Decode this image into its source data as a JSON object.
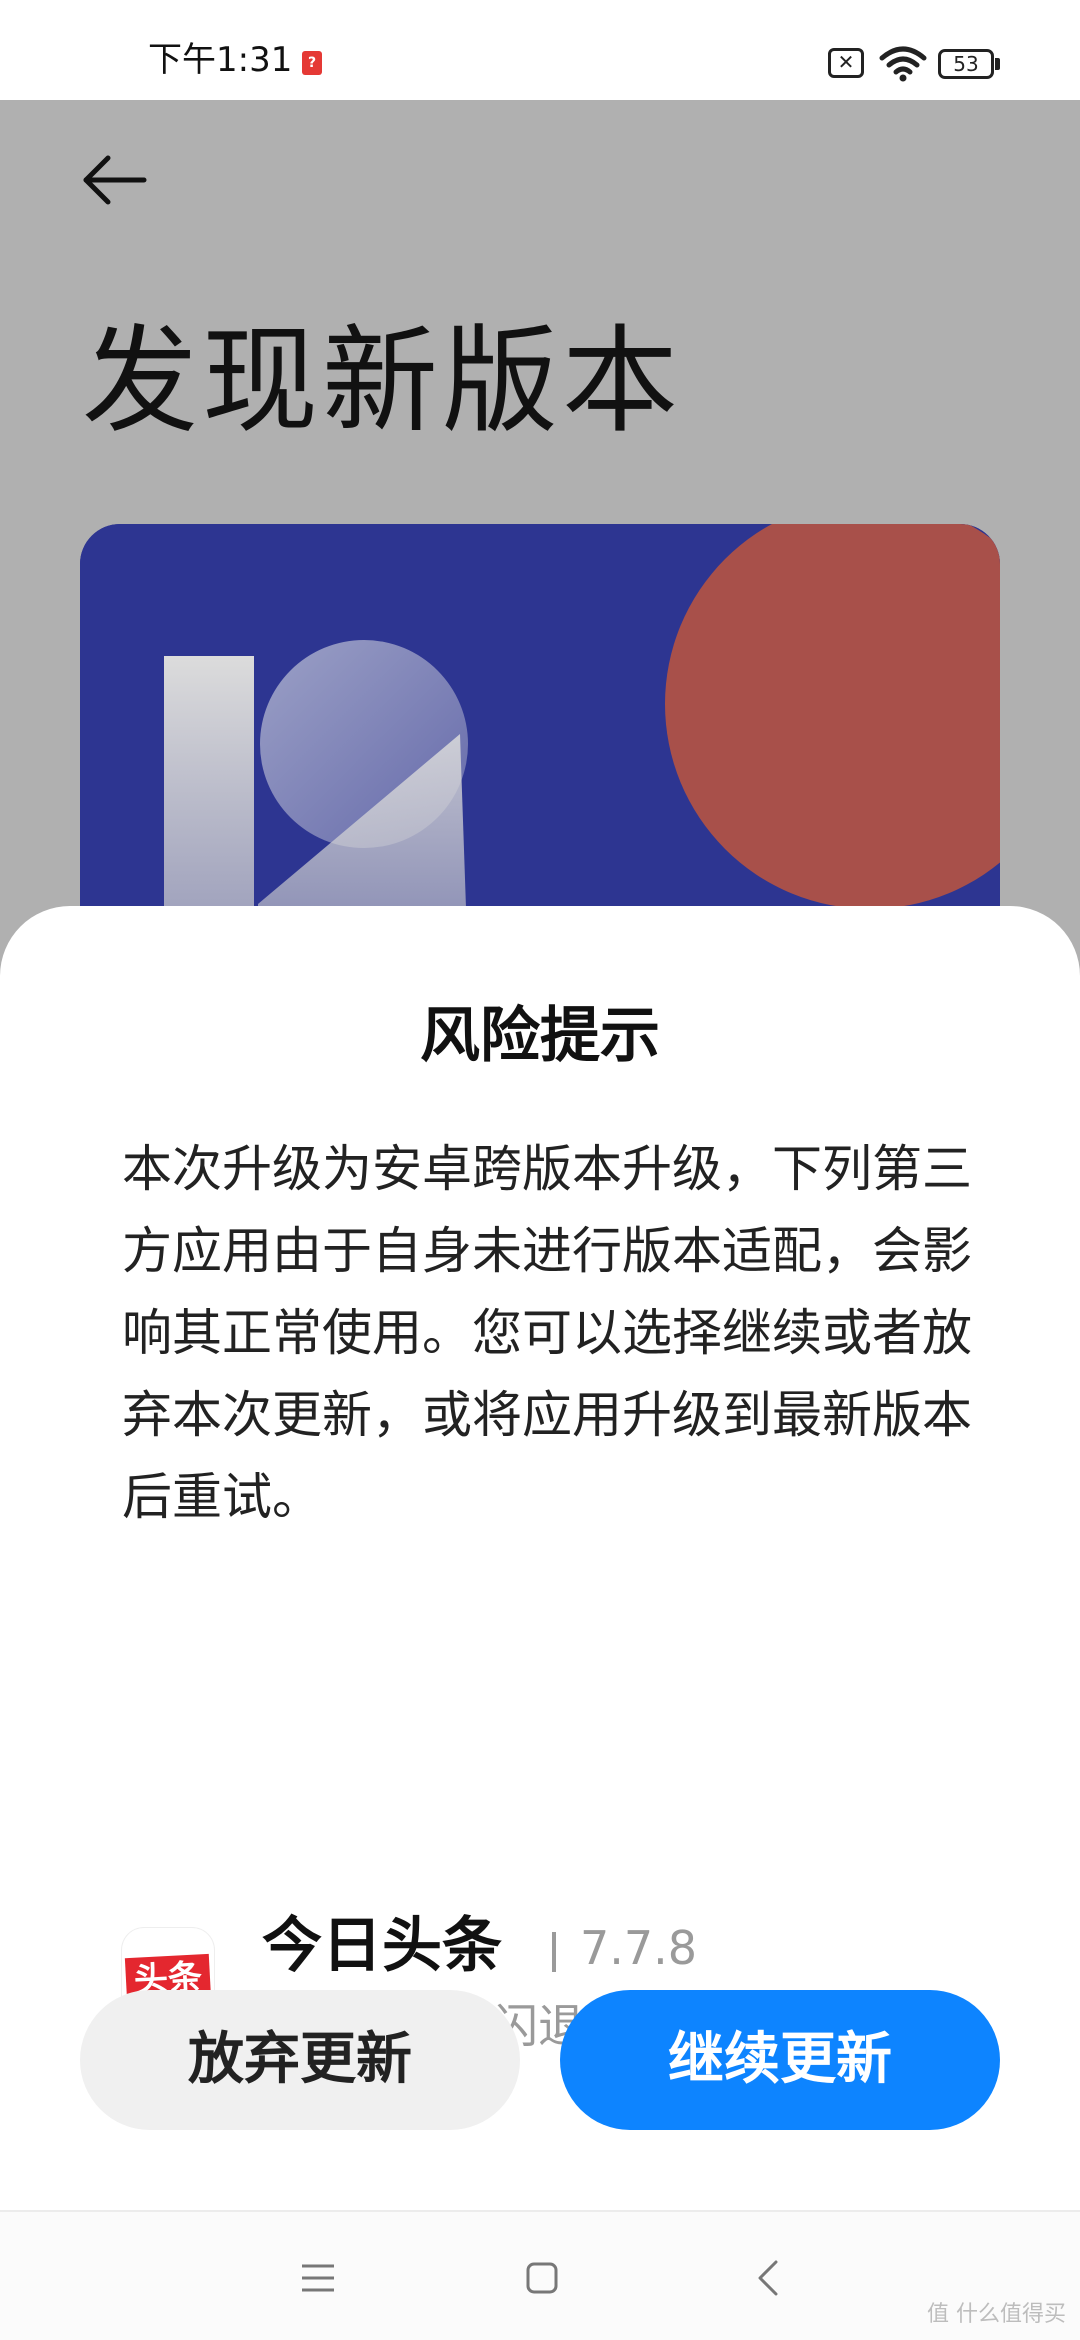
{
  "status_bar": {
    "time": "下午1:31",
    "battery": "53",
    "icons": [
      "notification-icon",
      "sim-icon",
      "wifi-icon",
      "battery-icon"
    ]
  },
  "background_page": {
    "title": "发现新版本",
    "banner_colors": {
      "blue": "#2d3591",
      "red": "#a8504a",
      "white": "#e0e0e0"
    }
  },
  "dialog": {
    "title": "风险提示",
    "message": "本次升级为安卓跨版本升级，下列第三方应用由于自身未进行版本适配，会影响其正常使用。您可以选择继续或者放弃本次更新，或将应用升级到最新版本后重试。",
    "app": {
      "icon_text": "头条",
      "name": "今日头条",
      "version": "7.7.8",
      "risk": "存在风险：闪退"
    },
    "buttons": {
      "cancel": "放弃更新",
      "continue": "继续更新"
    },
    "colors": {
      "accent": "#0d84ff"
    }
  },
  "nav_bar": {
    "icons": [
      "menu-icon",
      "home-icon",
      "back-icon"
    ],
    "watermark": "值 什么值得买"
  }
}
